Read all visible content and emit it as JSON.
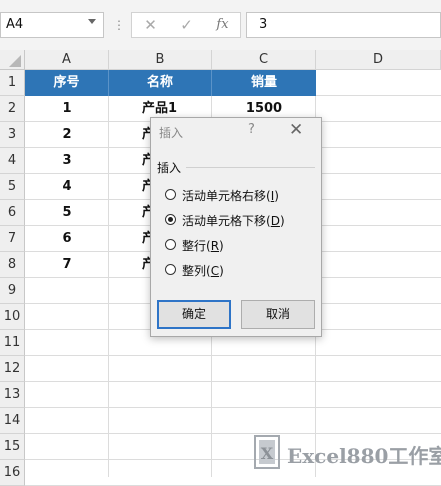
{
  "formula_bar": {
    "name_box": "A4",
    "fx_label": "fx",
    "formula_value": "3",
    "dots": "⋮",
    "cancel_icon": "✕",
    "confirm_icon": "✓"
  },
  "sheet": {
    "columns": [
      "A",
      "B",
      "C",
      "D"
    ],
    "rows": [
      "1",
      "2",
      "3",
      "4",
      "5",
      "6",
      "7",
      "8",
      "9",
      "10",
      "11",
      "12",
      "13",
      "14",
      "15",
      "16"
    ],
    "header_row": [
      "序号",
      "名称",
      "销量"
    ],
    "header_color": "#2e75b6",
    "col_a_values": [
      "1",
      "2",
      "3",
      "4",
      "5",
      "6",
      "7"
    ],
    "col_b_values": [
      "产品1",
      "产",
      "产",
      "产",
      "产",
      "产",
      "产"
    ],
    "col_c_values": [
      "1500"
    ]
  },
  "dialog": {
    "title": "插入",
    "help": "?",
    "close": "✕",
    "group_label": "插入",
    "options": [
      {
        "text": "活动单元格右移(",
        "key": "I",
        "end": ")",
        "checked": false
      },
      {
        "text": "活动单元格下移(",
        "key": "D",
        "end": ")",
        "checked": true
      },
      {
        "text": "整行(",
        "key": "R",
        "end": ")",
        "checked": false
      },
      {
        "text": "整列(",
        "key": "C",
        "end": ")",
        "checked": false
      }
    ],
    "ok_label": "确定",
    "cancel_label": "取消"
  },
  "watermark": {
    "text": "Excel880工作室",
    "logo_text": "X"
  }
}
